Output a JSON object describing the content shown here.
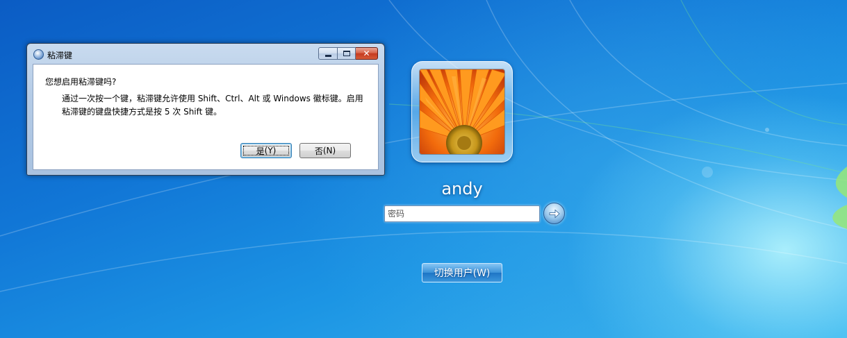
{
  "dialog": {
    "title": "粘滞键",
    "question": "您想启用粘滞键吗?",
    "message": "通过一次按一个键，粘滞键允许使用 Shift、Ctrl、Alt 或 Windows 徽标键。启用粘滞键的键盘快捷方式是按 5 次 Shift 键。",
    "yes_label": "是",
    "yes_accel": "(Y)",
    "no_label": "否",
    "no_accel": "(N)"
  },
  "login": {
    "username": "andy",
    "password_placeholder": "密码",
    "switch_user_label": "切换用户(W)"
  },
  "icons": {
    "dialog": "accessibility-icon",
    "submit": "arrow-right-icon",
    "window_min": "minimize-icon",
    "window_max": "maximize-icon",
    "window_close": "close-icon"
  },
  "colors": {
    "desktop_blue": "#1176d6",
    "close_red": "#c53a1f",
    "avatar_orange": "#f07c10"
  }
}
